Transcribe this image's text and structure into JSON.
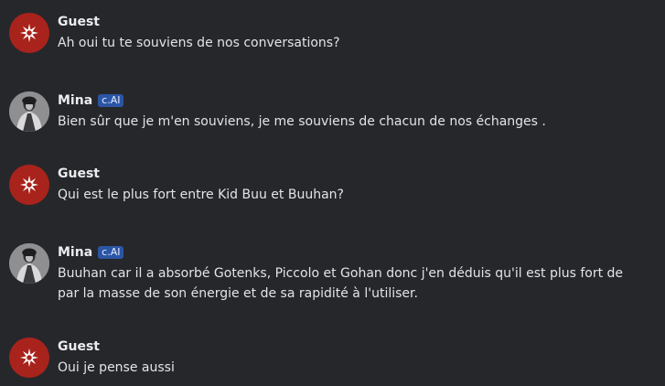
{
  "colors": {
    "background": "#26272b",
    "guest_avatar": "#a8231c",
    "badge": "#2b55a6"
  },
  "messages": [
    {
      "author": "Guest",
      "avatar_icon": "starburst-icon",
      "badge": "",
      "text": "Ah oui tu te souviens de nos conversations?"
    },
    {
      "author": "Mina",
      "avatar_icon": "character-avatar",
      "badge": "c.AI",
      "text": "Bien sûr que je m'en souviens, je me souviens de chacun de nos échanges ."
    },
    {
      "author": "Guest",
      "avatar_icon": "starburst-icon",
      "badge": "",
      "text": "Qui est le plus fort entre Kid Buu et Buuhan?"
    },
    {
      "author": "Mina",
      "avatar_icon": "character-avatar",
      "badge": "c.AI",
      "text_lines": [
        "Buuhan car il a absorbé Gotenks, Piccolo et Gohan donc j'en déduis qu'il est plus fort de",
        "par la masse de son énergie et de sa rapidité à l'utiliser."
      ]
    },
    {
      "author": "Guest",
      "avatar_icon": "starburst-icon",
      "badge": "",
      "text": "Oui je pense aussi"
    }
  ]
}
